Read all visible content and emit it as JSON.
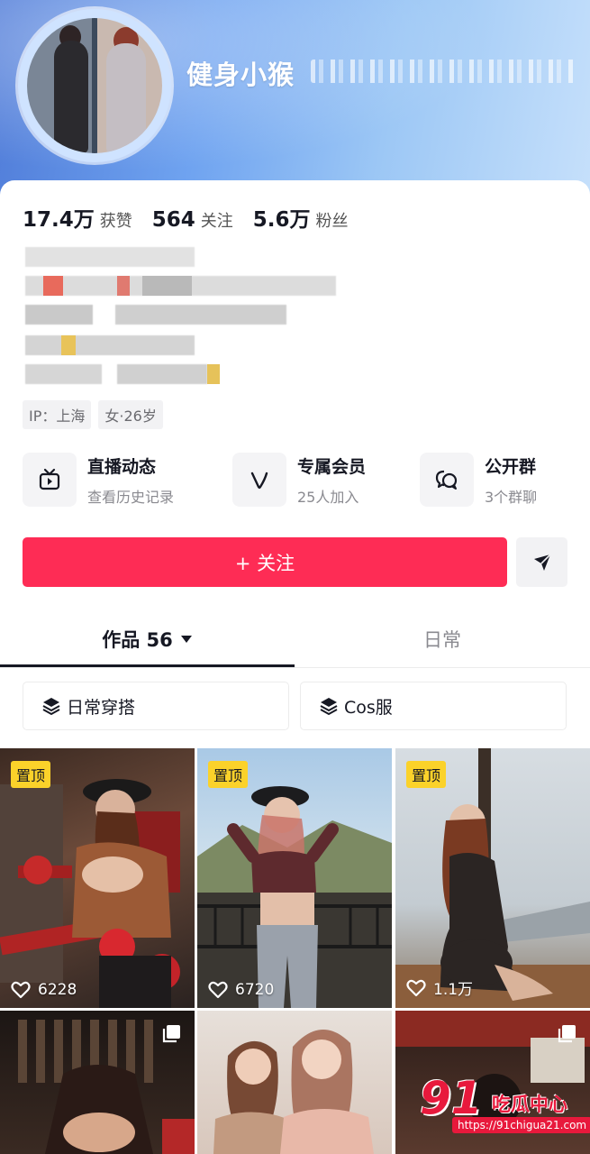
{
  "profile": {
    "nickname": "健身小猴",
    "stats": [
      {
        "num": "17.4万",
        "label": "获赞"
      },
      {
        "num": "564",
        "label": "关注"
      },
      {
        "num": "5.6万",
        "label": "粉丝"
      }
    ],
    "tags": [
      "IP：上海",
      "女·26岁"
    ]
  },
  "entries": [
    {
      "icon": "tv-icon",
      "title": "直播动态",
      "sub": "查看历史记录"
    },
    {
      "icon": "v-icon",
      "title": "专属会员",
      "sub": "25人加入"
    },
    {
      "icon": "chat-icon",
      "title": "公开群",
      "sub": "3个群聊"
    }
  ],
  "actions": {
    "follow_label": "+ 关注",
    "send_icon": "send-icon"
  },
  "tabs": {
    "works_label": "作品 56",
    "daily_label": "日常"
  },
  "collections": [
    {
      "icon": "layers-icon",
      "label": "日常穿搭"
    },
    {
      "icon": "layers-icon",
      "label": "Cos服"
    }
  ],
  "videos": [
    {
      "pinned": "置顶",
      "likes": "6228"
    },
    {
      "pinned": "置顶",
      "likes": "6720"
    },
    {
      "pinned": "置顶",
      "likes": "1.1万"
    }
  ],
  "watermark": {
    "big": "91",
    "text": "吃瓜中心",
    "url": "https://91chigua21.com"
  },
  "colors": {
    "accent": "#fe2c55",
    "pin": "#fbd22a",
    "header_start": "#4f7bd8",
    "header_end": "#c6e0fb"
  }
}
